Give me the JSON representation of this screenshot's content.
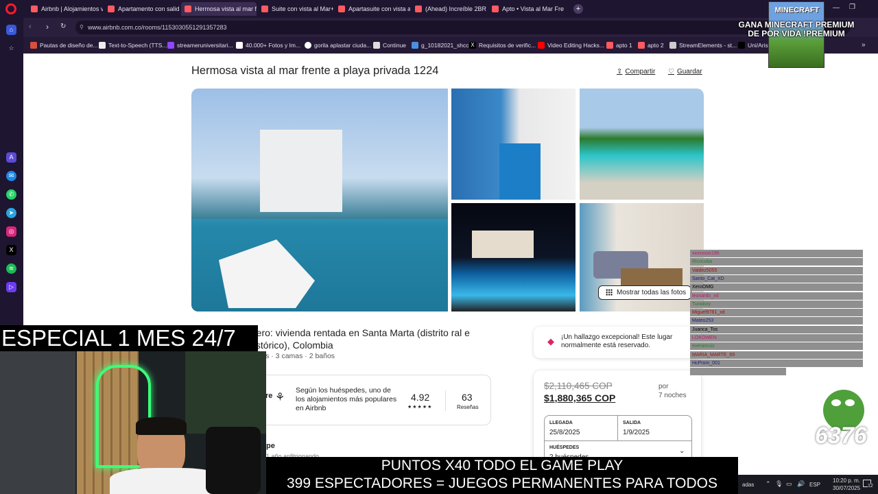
{
  "browser": {
    "tabs": [
      {
        "label": "Airbnb | Alojamientos vac"
      },
      {
        "label": "Apartamento con salida d"
      },
      {
        "label": "Hermosa vista al mar fren"
      },
      {
        "label": "Suite con vista al Mar+Jac"
      },
      {
        "label": "Apartasuite con vista al m"
      },
      {
        "label": "(Ahead) Increíble 2BR @R"
      },
      {
        "label": "Apto • Vista al Mar Frente"
      }
    ],
    "url": "www.airbnb.com.co/rooms/1153030551291357283",
    "bookmarks": [
      {
        "label": "Pautas de diseño de..."
      },
      {
        "label": "Text-to-Speech (TTS..."
      },
      {
        "label": "streameruniversitari..."
      },
      {
        "label": "40.000+ Fotos y Im..."
      },
      {
        "label": "gorila aplastar ciuda..."
      },
      {
        "label": "Continue"
      },
      {
        "label": "g_10182021_shcc"
      },
      {
        "label": "Requisitos de verific..."
      },
      {
        "label": "Video Editing Hacks..."
      },
      {
        "label": "apto 1"
      },
      {
        "label": "apto 2"
      },
      {
        "label": "StreamElements - st..."
      },
      {
        "label": "Uni/Aris"
      }
    ]
  },
  "listing": {
    "title": "Hermosa vista al mar frente a playa privada 1224",
    "share_label": "Compartir",
    "save_label": "Guardar",
    "show_all_label": "Mostrar todas las fotos",
    "heading": "ntero: vivienda rentada en Santa Marta (distrito ral e histórico), Colombia",
    "details": "ciones · 3 camas · 2 baños",
    "guest_fav": {
      "left_fragment": "re",
      "text": "Según los huéspedes, uno de los alojamientos más populares en Airbnb",
      "rating": "4.92",
      "stars": "★★★★★",
      "reviews_count": "63",
      "reviews_label": "Reseñas"
    },
    "host_fragment": "pe",
    "host_sub": "1 año anfitrionando"
  },
  "booking": {
    "find_text": "¡Un hallazgo excepcional! Este lugar normalmente está reservado.",
    "old_price": "$2,110,465 COP",
    "new_price": "$1,880,365 COP",
    "per_label": "por",
    "nights_label": "7 noches",
    "checkin_label": "LLEGADA",
    "checkin_value": "25/8/2025",
    "checkout_label": "SALIDA",
    "checkout_value": "1/9/2025",
    "guests_label": "HUÉSPEDES",
    "guests_value": "2 huéspedes"
  },
  "overlay": {
    "especial": "ESPECIAL 1 MES 24/7",
    "line1": "PUNTOS X40 TODO EL GAME PLAY",
    "line2": "399 ESPECTADORES = JUEGOS PERMANENTES PARA TODOS",
    "mc_logo": "MINECRAFT",
    "mc_promo": "GANA MINECRAFT PREMIUM DE POR VIDA !PREMIUM",
    "pepe_count": "6376",
    "chat": [
      "xxxxxxxx195",
      "Ricocuba",
      "Valdez5055",
      "Santo_Cat_XD",
      "XeroOMG",
      "leonardo_xd",
      "Tunaboy",
      "Miguel9781_xd",
      "Mateo253",
      "Juanca_Tos",
      "LOKOWEN",
      "everanruiz",
      "MARIA_MARTE_69",
      "HcProm_001"
    ]
  },
  "taskbar": {
    "lang": "ESP",
    "time": "10:20 p. m.",
    "date": "30/07/2025",
    "notif_count": "12",
    "left_fragment": "adas"
  }
}
